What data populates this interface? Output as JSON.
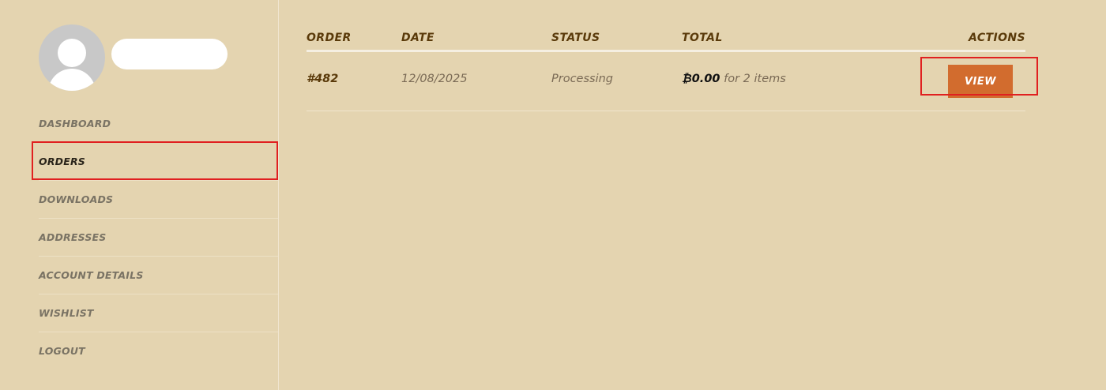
{
  "nav": {
    "items": [
      {
        "label": "DASHBOARD"
      },
      {
        "label": "ORDERS"
      },
      {
        "label": "DOWNLOADS"
      },
      {
        "label": "ADDRESSES"
      },
      {
        "label": "ACCOUNT DETAILS"
      },
      {
        "label": "WISHLIST"
      },
      {
        "label": "LOGOUT"
      }
    ],
    "active": "ORDERS"
  },
  "orders": {
    "columns": {
      "order": "ORDER",
      "date": "DATE",
      "status": "STATUS",
      "total": "TOTAL",
      "actions": "ACTIONS"
    },
    "rows": [
      {
        "number": "#482",
        "date": "12/08/2025",
        "status": "Processing",
        "amount": "₿0.00",
        "count_text": "for 2 items",
        "action_label": "VIEW"
      }
    ]
  },
  "colors": {
    "background": "#e4d4b0",
    "accent": "#d26c2e",
    "heading": "#5a3a0a",
    "highlight": "#e02020"
  }
}
